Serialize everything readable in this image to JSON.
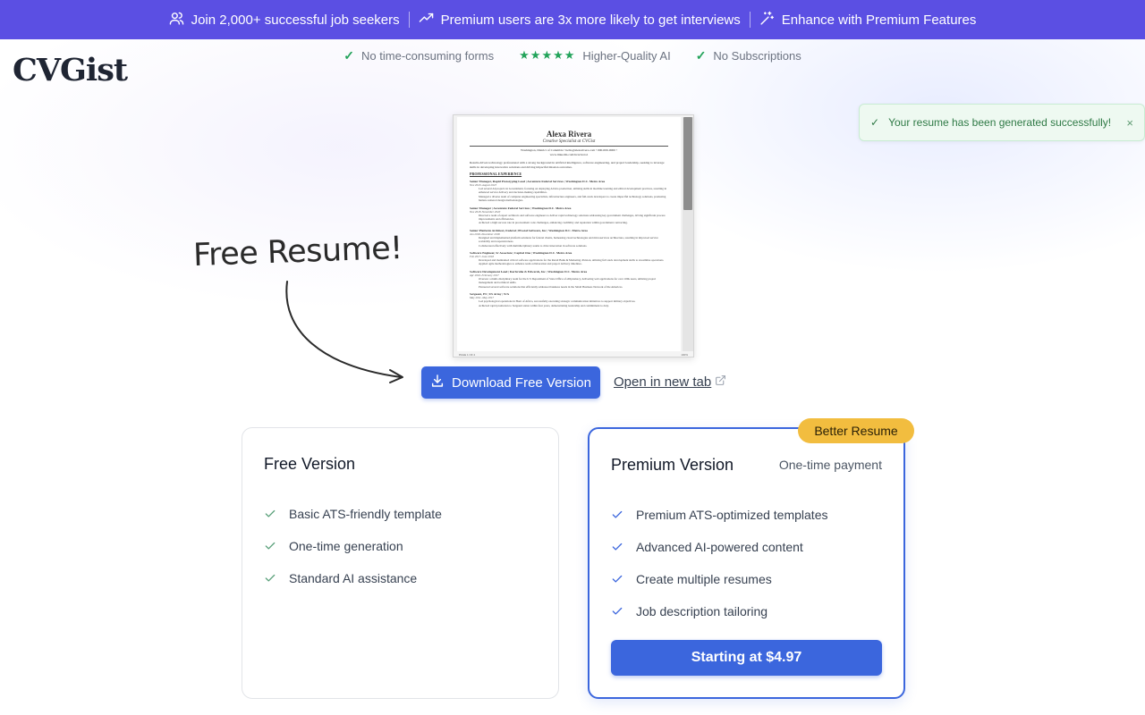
{
  "banner": {
    "items": [
      {
        "icon": "users-icon",
        "text": "Join 2,000+ successful job seekers"
      },
      {
        "icon": "trending-up-icon",
        "text": "Premium users are 3x more likely to get interviews"
      },
      {
        "icon": "sparkle-wand-icon",
        "text": "Enhance with Premium Features"
      }
    ]
  },
  "header": {
    "logo": "CVGist",
    "features": [
      {
        "icon": "check-icon",
        "text": "No time-consuming forms"
      },
      {
        "icon": "five-stars-icon",
        "text": "Higher-Quality AI"
      },
      {
        "icon": "check-icon",
        "text": "No Subscriptions"
      }
    ]
  },
  "toast": {
    "icon": "check-icon",
    "message": "Your resume has been generated successfully!",
    "close": "×"
  },
  "resume": {
    "name": "Alexa Rivera",
    "title": "Creative Specialist at CVGist",
    "contact_1": "Washington, District of Columbia • hello@alexarivera.com • 000-000-0000 •",
    "contact_2": "www.linkedin.com/in/arivera1",
    "summary": "Results-driven technology professional with a strong background in artificial intelligence, software engineering, and project leadership, seeking to leverage skills in developing innovative solutions and driving impactful mission outcomes.",
    "section": "PROFESSIONAL EXPERIENCE",
    "jobs": [
      {
        "role": "Senior Manager, Rapid Prototyping Lead | Accenture Federal Services | Washington D.C. Metro Area",
        "dates": "Nov 2020–August 2023",
        "bullets": [
          "Led several AI projects in Government, focusing on deploying AI into production, utilizing skills in machine learning and ethical development practices, resulting in enhanced service delivery and decision-making capabilities.",
          "Managed a diverse team of computer engineering specialists, infrastructure engineers, and full-stack developers to create impactful technology solutions, promoting human-centered design methodologies."
        ]
      },
      {
        "role": "Senior Manager | Accenture Federal Services | Washington D.C. Metro Area",
        "dates": "Nov 2018–November 2020",
        "bullets": [
          "Directed a team of expert architects and software engineers to deliver rapid technology solutions addressing key government challenges, driving significant process improvements and efficiencies.",
          "Achieved a high success rate in procurement code challenges, enhancing credibility and reputation within government contracting."
        ]
      },
      {
        "role": "Senior Platform Architect, Federal | Pivotal Software, Inc | Washington D.C. Metro Area",
        "dates": "Jan 2018–November 2018",
        "bullets": [
          "Designed and implemented platform solutions for federal clients, harnessing cloud technologies and microservices architecture, resulting in improved service scalability and responsiveness.",
          "Collaborated effectively with multidisciplinary teams to drive innovation in software solutions."
        ]
      },
      {
        "role": "Software Engineer, Sr Associate | Capital One | Washington D.C. Metro Area",
        "dates": "Feb 2017–June 2018",
        "bullets": [
          "Developed and maintained critical software applications for the Retail Bank & Marketing division, utilizing full stack development skills to streamline operations.",
          "Applied agile methodologies to enhance team collaboration and project delivery timelines."
        ]
      },
      {
        "role": "Software Development Lead | Karlsruhe & Edwards, Inc | Washington D.C. Metro Area",
        "dates": "Apr 2016–February 2017",
        "bullets": [
          "Oversaw a multi-disciplinary team for the U.S Department of State Office of eDiplomacy, delivering web applications for over 100k users, utilizing project management and technical skills.",
          "Pioneered several software solutions that efficiently addressed business needs in the Small Business Network of the Americas."
        ]
      },
      {
        "role": "Sergeant, E5 | US Army | N/A",
        "dates": "May 2011–May 2017",
        "bullets": [
          "Led psychological operations in Horn of Africa, successfully executing strategic communication initiatives to support military objectives.",
          "Achieved rapid promotion to Sergeant status within four years, demonstrating leadership and commitment to duty."
        ]
      }
    ],
    "page_label": "PAGE 1 OF 2",
    "zoom_label": "100%"
  },
  "callout": {
    "text": "Free Resume!"
  },
  "actions": {
    "download_label": "Download Free Version",
    "open_label": "Open in new tab"
  },
  "plans": {
    "free": {
      "title": "Free Version",
      "features": [
        "Basic ATS-friendly template",
        "One-time generation",
        "Standard AI assistance"
      ]
    },
    "premium": {
      "badge": "Better Resume",
      "title": "Premium Version",
      "subtitle": "One-time payment",
      "features": [
        "Premium ATS-optimized templates",
        "Advanced AI-powered content",
        "Create multiple resumes",
        "Job description tailoring"
      ],
      "cta": "Starting at $4.97"
    }
  },
  "colors": {
    "banner": "#5b4fe3",
    "primary": "#3b66dd",
    "badge": "#f2bd3f",
    "success": "#22a35a"
  }
}
